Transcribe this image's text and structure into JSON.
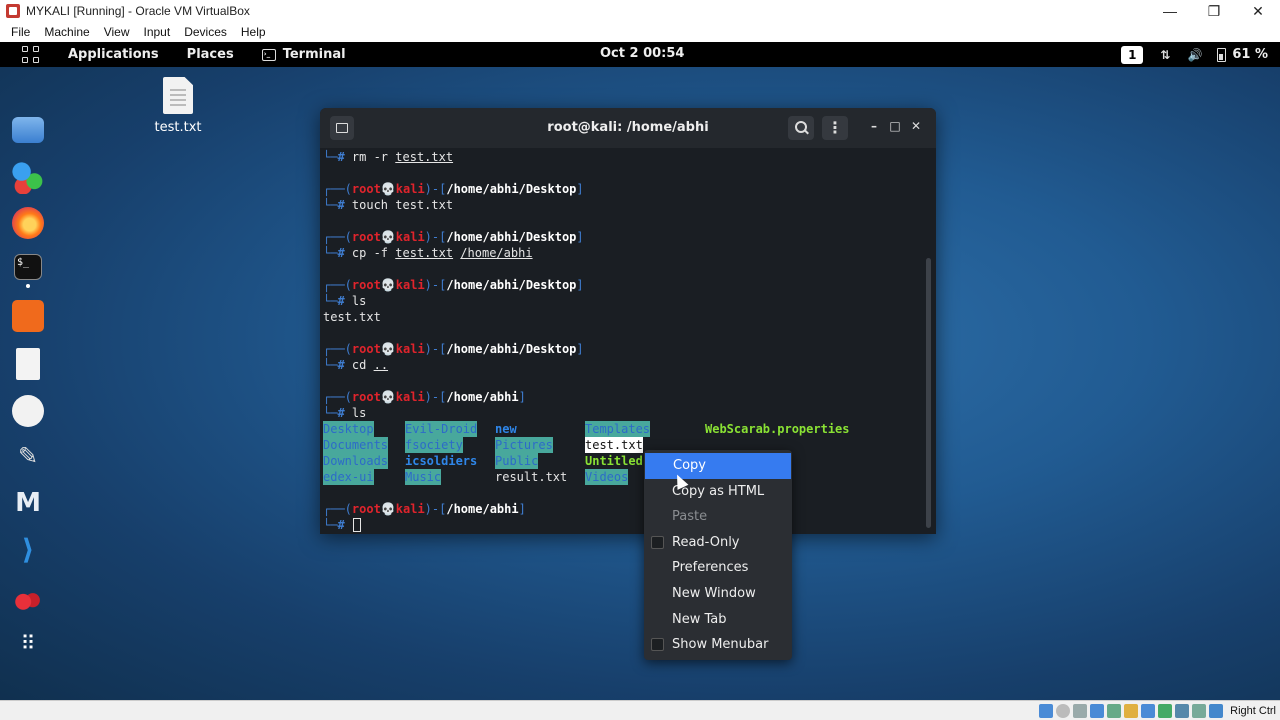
{
  "vbox": {
    "title": "MYKALI [Running] - Oracle VM VirtualBox",
    "minimize": "—",
    "restore": "❐",
    "close": "✕",
    "menu": [
      "File",
      "Machine",
      "View",
      "Input",
      "Devices",
      "Help"
    ],
    "host_key": "Right Ctrl"
  },
  "topbar": {
    "applications": "Applications",
    "places": "Places",
    "terminal": "Terminal",
    "clock": "Oct 2  00:54",
    "workspace": "1",
    "battery": "61 %"
  },
  "desktop": {
    "file_label": "test.txt"
  },
  "terminal": {
    "title": "root@kali: /home/abhi",
    "menu_dots": "⋮",
    "minimize": "–",
    "maximize": "□",
    "close": "✕",
    "prompt_user": "root",
    "prompt_skull": "💀",
    "prompt_host": "kali",
    "lines": {
      "l0_cmd": "rm -r ",
      "l0_arg": "test.txt",
      "p1_path": "/home/abhi/Desktop",
      "l1_cmd": "touch test.txt",
      "p2_path": "/home/abhi/Desktop",
      "l2_cmd": "cp -f ",
      "l2_arg1": "test.txt",
      "l2_arg2": "/home/abhi",
      "p3_path": "/home/abhi/Desktop",
      "l3_cmd": "ls",
      "l3_out": "test.txt",
      "p4_path": "/home/abhi/Desktop",
      "l4_cmd": "cd ",
      "l4_arg": "..",
      "p5_path": "/home/abhi",
      "l5_cmd": "ls",
      "p6_path": "/home/abhi"
    },
    "ls": {
      "col1": [
        "Desktop",
        "Documents",
        "Downloads",
        "edex-ui"
      ],
      "col2": [
        "Evil-Droid",
        "fsociety",
        "icsoldiers",
        "Music"
      ],
      "col3": [
        "new",
        "Pictures",
        "Public",
        "result.txt"
      ],
      "col4": [
        "Templates",
        "test.txt",
        "Untitled",
        "Videos"
      ],
      "col5": [
        "WebScarab.properties"
      ]
    }
  },
  "context_menu": {
    "items": [
      "Copy",
      "Copy as HTML",
      "Paste",
      "Read-Only",
      "Preferences",
      "New Window",
      "New Tab",
      "Show Menubar"
    ]
  }
}
